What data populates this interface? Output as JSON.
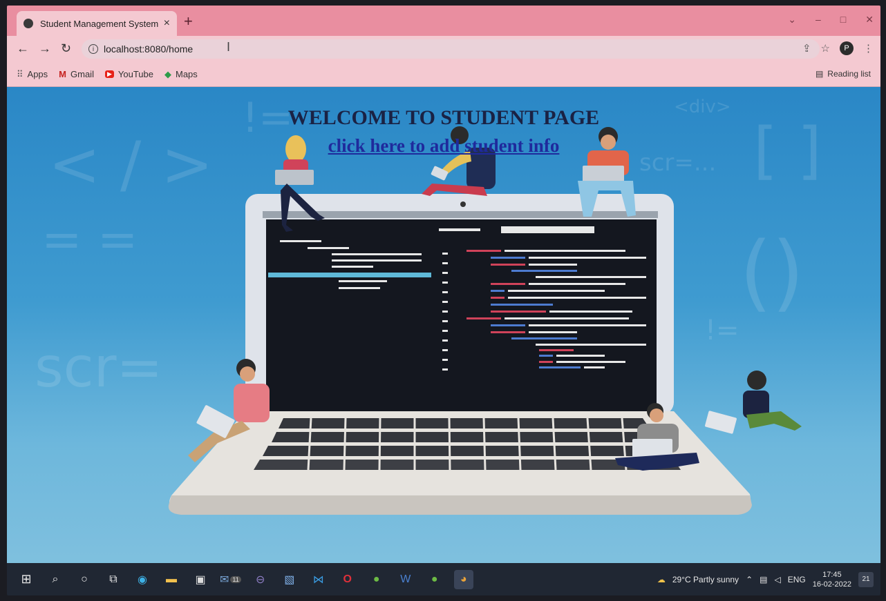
{
  "browser": {
    "tab_title": "Student Management System",
    "tab_close": "×",
    "new_tab": "+",
    "url": "localhost:8080/home",
    "profile_initial": "P",
    "bookmarks": [
      {
        "label": "Apps",
        "icon": "apps-grid-icon",
        "glyph": "⠿",
        "color": "#555555"
      },
      {
        "label": "Gmail",
        "icon": "gmail-icon",
        "glyph": "M",
        "color": "#c5221f"
      },
      {
        "label": "YouTube",
        "icon": "youtube-icon",
        "glyph": "▶",
        "color": "#e62117"
      },
      {
        "label": "Maps",
        "icon": "maps-icon",
        "glyph": "◆",
        "color": "#2e9b49"
      }
    ],
    "reading_list": "Reading list"
  },
  "page": {
    "heading": "WELCOME TO STUDENT PAGE",
    "link_text": "click here to add student info"
  },
  "taskbar": {
    "weather": "29°C  Partly sunny",
    "language": "ENG",
    "time": "17:45",
    "date": "16-02-2022",
    "notifications": "21",
    "mail_badge": "11"
  },
  "colors": {
    "tab_bar": "#e98ea0",
    "toolbar": "#f4c9d1",
    "page_top": "#2a87c6",
    "heading": "#1a2244",
    "link": "#1f2a9c",
    "taskbar": "#202733"
  }
}
